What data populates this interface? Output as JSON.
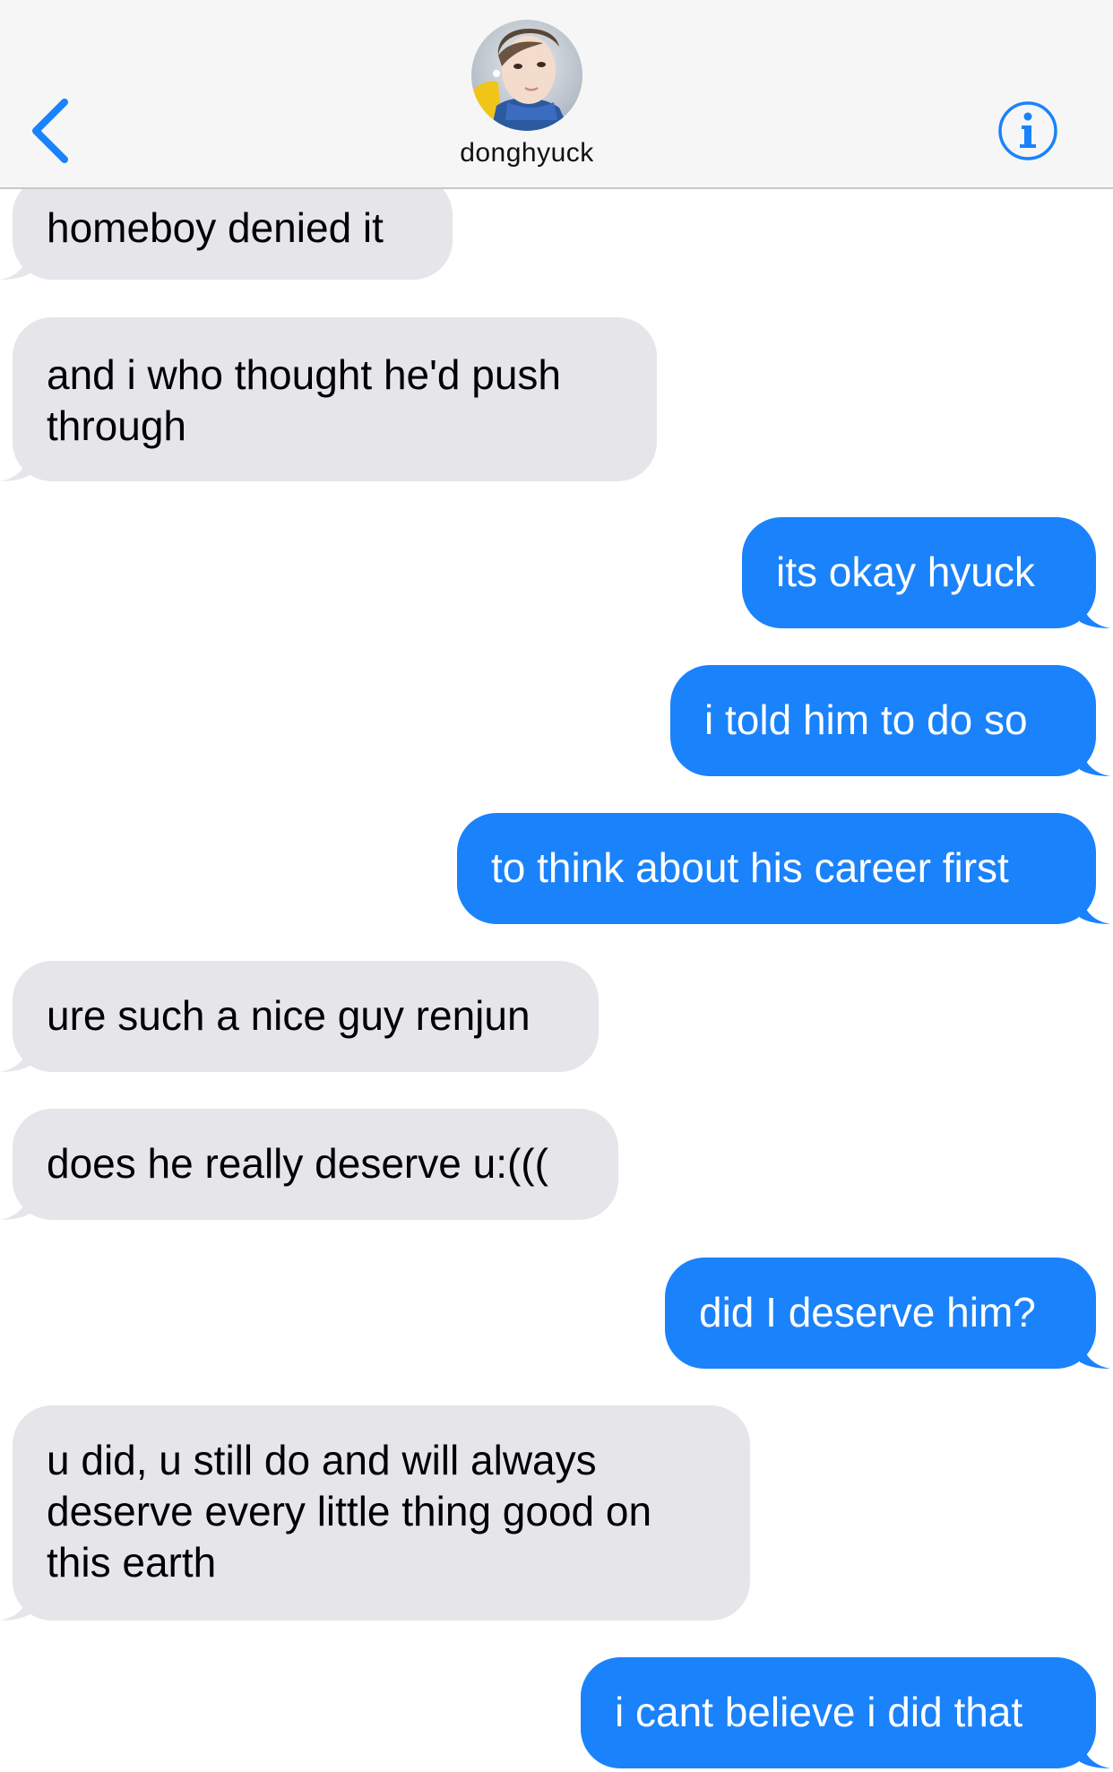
{
  "header": {
    "contact_name": "donghyuck",
    "back_icon": "chevron-left-icon",
    "info_icon": "info-icon",
    "accent_color": "#1a82fb"
  },
  "messages": [
    {
      "from": "them",
      "text": "homeboy denied it"
    },
    {
      "from": "them",
      "text": "and i who thought he'd push\nthrough"
    },
    {
      "from": "me",
      "text": "its okay hyuck"
    },
    {
      "from": "me",
      "text": "i told him to do so"
    },
    {
      "from": "me",
      "text": "to think about his career first"
    },
    {
      "from": "them",
      "text": "ure such a nice guy renjun"
    },
    {
      "from": "them",
      "text": "does he really deserve u:((("
    },
    {
      "from": "me",
      "text": "did I deserve him?"
    },
    {
      "from": "them",
      "text": "u did, u still do and will always\ndeserve every little thing good on\nthis earth"
    },
    {
      "from": "me",
      "text": "i cant believe i did that"
    }
  ],
  "colors": {
    "incoming_bubble": "#e5e5ea",
    "outgoing_bubble": "#1a82fb",
    "header_bg": "#f6f6f6"
  }
}
